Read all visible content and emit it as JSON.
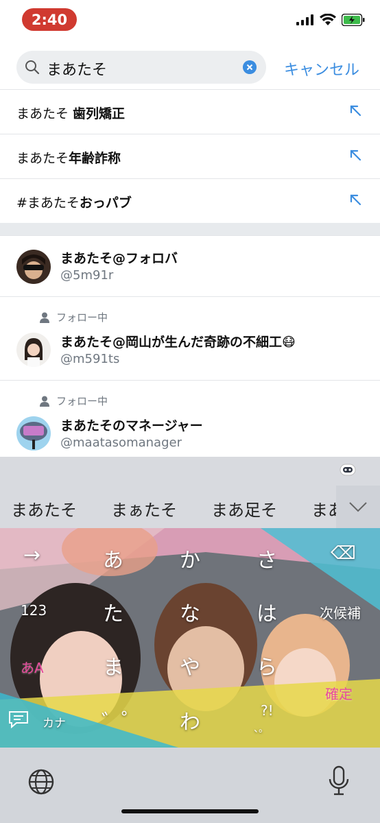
{
  "status_bar": {
    "time": "2:40",
    "icons": [
      "signal-icon",
      "wifi-icon",
      "battery-charging-icon"
    ]
  },
  "search": {
    "query": "まあたそ",
    "cancel_label": "キャンセル"
  },
  "suggestions": [
    {
      "plain": "まあたそ ",
      "bold": "歯列矯正"
    },
    {
      "plain": "まあたそ",
      "bold": "年齢詐称"
    },
    {
      "plain": "#まあたそ",
      "bold": "おっパブ"
    }
  ],
  "users": [
    {
      "name": "まあたそ@フォロバ",
      "handle": "@5m91r",
      "following": ""
    },
    {
      "name": "まあたそ@岡山が生んだ奇跡の不細工😷",
      "handle": "@m591ts",
      "following": "フォロー中"
    },
    {
      "name": "まあたそのマネージャー",
      "handle": "@maatasomanager",
      "following": "フォロー中"
    }
  ],
  "keyboard": {
    "candidates": [
      "まあたそ",
      "まぁたそ",
      "まあ足そ",
      "まあ"
    ],
    "keys": {
      "row1": [
        "→",
        "あ",
        "か",
        "さ",
        "⌫"
      ],
      "row2": [
        "123",
        "た",
        "な",
        "は",
        "次候補"
      ],
      "row3": [
        "あA",
        "ま",
        "や",
        "ら",
        "確定"
      ],
      "row4": [
        "カナ",
        "゛ ゚",
        "わ",
        "?!"
      ],
      "row4_small": [
        "、。"
      ]
    },
    "colors": {
      "accent_pink": "#e84b9c",
      "accent_blue": "#3b8de0",
      "time_red": "#d03a30"
    }
  }
}
